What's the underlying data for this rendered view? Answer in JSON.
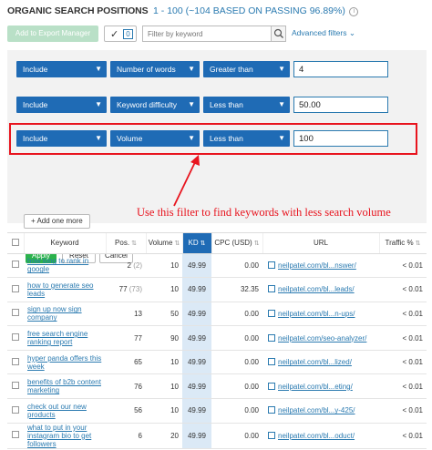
{
  "header": {
    "title": "ORGANIC SEARCH POSITIONS",
    "range": "1 - 100 (~104 BASED ON PASSING 96.89%)",
    "info_icon": "i"
  },
  "toolbar": {
    "export_label": "Add to Export Manager",
    "selected_count": "0",
    "search_placeholder": "Filter by keyword",
    "advanced_filters_label": "Advanced filters"
  },
  "filters": [
    {
      "mode": "Include",
      "field": "Number of words",
      "operator": "Greater than",
      "value": "4"
    },
    {
      "mode": "Include",
      "field": "Keyword difficulty",
      "operator": "Less than",
      "value": "50.00"
    },
    {
      "mode": "Include",
      "field": "Volume",
      "operator": "Less than",
      "value": "100"
    }
  ],
  "buttons": {
    "add_more": "Add one more",
    "apply": "Apply",
    "reset": "Reset",
    "cancel": "Cancel"
  },
  "annotation": {
    "text": "Use this filter to find keywords with less search volume",
    "color": "#e8141e"
  },
  "table": {
    "headers": {
      "keyword": "Keyword",
      "pos": "Pos.",
      "volume": "Volume",
      "kd": "KD",
      "cpc": "CPC (USD)",
      "url": "URL",
      "traffic": "Traffic %"
    },
    "rows": [
      {
        "keyword": "how long to rank in google",
        "pos": "2",
        "pos_prev": "(2)",
        "volume": "10",
        "kd": "49.99",
        "cpc": "0.00",
        "url": "neilpatel.com/bl...nswer/",
        "traffic": "< 0.01"
      },
      {
        "keyword": "how to generate seo leads",
        "pos": "77",
        "pos_prev": "(73)",
        "volume": "10",
        "kd": "49.99",
        "cpc": "32.35",
        "url": "neilpatel.com/bl...leads/",
        "traffic": "< 0.01"
      },
      {
        "keyword": "sign up now sign company",
        "pos": "13",
        "pos_prev": "",
        "volume": "50",
        "kd": "49.99",
        "cpc": "0.00",
        "url": "neilpatel.com/bl...n-ups/",
        "traffic": "< 0.01"
      },
      {
        "keyword": "free search engine ranking report",
        "pos": "77",
        "pos_prev": "",
        "volume": "90",
        "kd": "49.99",
        "cpc": "0.00",
        "url": "neilpatel.com/seo-analyzer/",
        "traffic": "< 0.01"
      },
      {
        "keyword": "hyper panda offers this week",
        "pos": "65",
        "pos_prev": "",
        "volume": "10",
        "kd": "49.99",
        "cpc": "0.00",
        "url": "neilpatel.com/bl...lized/",
        "traffic": "< 0.01"
      },
      {
        "keyword": "benefits of b2b content marketing",
        "pos": "76",
        "pos_prev": "",
        "volume": "10",
        "kd": "49.99",
        "cpc": "0.00",
        "url": "neilpatel.com/bl...eting/",
        "traffic": "< 0.01"
      },
      {
        "keyword": "check out our new products",
        "pos": "56",
        "pos_prev": "",
        "volume": "10",
        "kd": "49.99",
        "cpc": "0.00",
        "url": "neilpatel.com/bl...y-425/",
        "traffic": "< 0.01"
      },
      {
        "keyword": "what to put in your instagram bio to get followers",
        "pos": "6",
        "pos_prev": "",
        "volume": "20",
        "kd": "49.99",
        "cpc": "0.00",
        "url": "neilpatel.com/bl...oduct/",
        "traffic": "< 0.01"
      }
    ]
  }
}
